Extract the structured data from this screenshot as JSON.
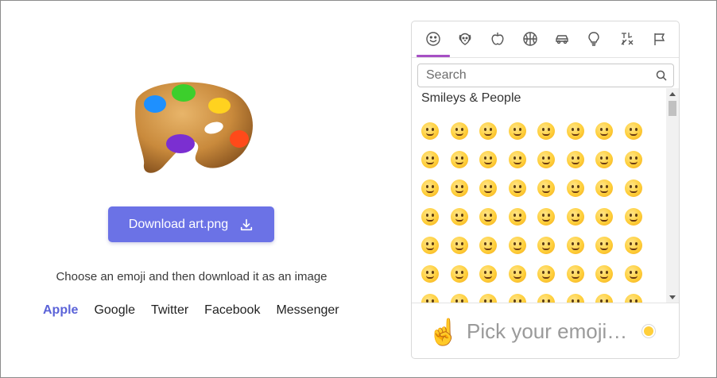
{
  "download_button": {
    "label": "Download art.png",
    "icon": "download-icon"
  },
  "tagline": "Choose an emoji and then download it as an image",
  "vendors": [
    "Apple",
    "Google",
    "Twitter",
    "Facebook",
    "Messenger"
  ],
  "selected_vendor": "Apple",
  "picker": {
    "categories": [
      "smileys-icon",
      "animals-icon",
      "food-icon",
      "activity-icon",
      "travel-icon",
      "objects-icon",
      "symbols-icon",
      "flags-icon"
    ],
    "search_placeholder": "Search",
    "section_title": "Smileys & People",
    "preview_emoji": "☝️",
    "preview_placeholder": "Pick your emoji…",
    "accent": "#a64fc4"
  }
}
